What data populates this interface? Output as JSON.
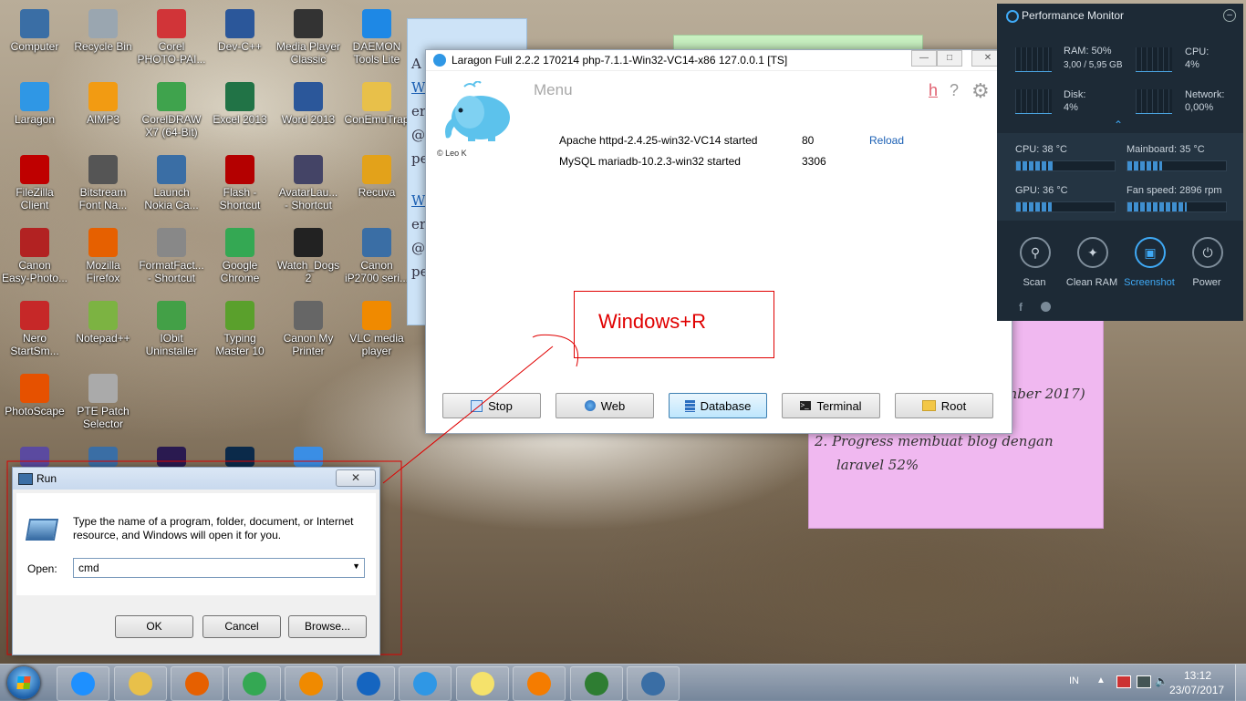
{
  "desktop": {
    "icons": [
      {
        "label": "Computer",
        "icon": "computer-icon",
        "color": "#3a6ea5"
      },
      {
        "label": "Recycle Bin",
        "icon": "recycle-bin-icon",
        "color": "#9aa6b0"
      },
      {
        "label": "Corel\nPHOTO-PAI...",
        "icon": "corel-photo-paint-icon",
        "color": "#d13438"
      },
      {
        "label": "Dev-C++",
        "icon": "devcpp-icon",
        "color": "#2b579a"
      },
      {
        "label": "Media Player\nClassic",
        "icon": "media-player-icon",
        "color": "#333333"
      },
      {
        "label": "DAEMON\nTools Lite",
        "icon": "daemon-tools-icon",
        "color": "#1e88e5"
      },
      {
        "label": "Laragon",
        "icon": "laragon-icon",
        "color": "#2f97e5"
      },
      {
        "label": "AIMP3",
        "icon": "aimp-icon",
        "color": "#f29b12"
      },
      {
        "label": "CorelDRAW\nX7 (64-Bit)",
        "icon": "coreldraw-icon",
        "color": "#3fa34d"
      },
      {
        "label": "Excel 2013",
        "icon": "excel-icon",
        "color": "#217346"
      },
      {
        "label": "Word 2013",
        "icon": "word-icon",
        "color": "#2b579a"
      },
      {
        "label": "ConEmuTrap",
        "icon": "folder-icon",
        "color": "#e8c04a"
      },
      {
        "label": "FileZilla\nClient",
        "icon": "filezilla-icon",
        "color": "#bf0000"
      },
      {
        "label": "Bitstream\nFont Na...",
        "icon": "bitstream-icon",
        "color": "#555555"
      },
      {
        "label": "Launch\nNokia Ca...",
        "icon": "nokia-icon",
        "color": "#3a6ea5"
      },
      {
        "label": "Flash -\nShortcut",
        "icon": "flash-icon",
        "color": "#b40000"
      },
      {
        "label": "AvatarLau...\n- Shortcut",
        "icon": "avatar-icon",
        "color": "#444466"
      },
      {
        "label": "Recuva",
        "icon": "recuva-icon",
        "color": "#e3a21a"
      },
      {
        "label": "Canon\nEasy-Photo...",
        "icon": "canon-icon",
        "color": "#b22222"
      },
      {
        "label": "Mozilla\nFirefox",
        "icon": "firefox-icon",
        "color": "#e66000"
      },
      {
        "label": "FormatFact...\n- Shortcut",
        "icon": "format-factory-icon",
        "color": "#888888"
      },
      {
        "label": "Google\nChrome",
        "icon": "chrome-icon",
        "color": "#34a853"
      },
      {
        "label": "Watch_Dogs\n2",
        "icon": "watchdogs-icon",
        "color": "#222222"
      },
      {
        "label": "Canon\niP2700 seri...",
        "icon": "canon-printer-icon",
        "color": "#3a6ea5"
      },
      {
        "label": "Nero\nStartSm...",
        "icon": "nero-icon",
        "color": "#c62828"
      },
      {
        "label": "Notepad++",
        "icon": "notepadpp-icon",
        "color": "#7cb342"
      },
      {
        "label": "IObit\nUninstaller",
        "icon": "iobit-icon",
        "color": "#43a047"
      },
      {
        "label": "Typing\nMaster 10",
        "icon": "typing-master-icon",
        "color": "#5aa02c"
      },
      {
        "label": "Canon My\nPrinter",
        "icon": "canon-myprinter-icon",
        "color": "#666666"
      },
      {
        "label": "VLC media\nplayer",
        "icon": "vlc-icon",
        "color": "#f08a00"
      },
      {
        "label": "PhotoScape",
        "icon": "photoscape-icon",
        "color": "#e65100"
      },
      {
        "label": "PTE Patch\nSelector",
        "icon": "pte-icon",
        "color": "#aaaaaa"
      }
    ],
    "partial_icons": [
      {
        "icon": "generic-app-icon",
        "color": "#5b4aa0"
      },
      {
        "icon": "generic-app-icon",
        "color": "#3a6ea5"
      },
      {
        "icon": "after-effects-icon",
        "color": "#2a1a50"
      },
      {
        "icon": "photoshop-icon",
        "color": "#0b2a4a"
      },
      {
        "icon": "generic-app-icon",
        "color": "#3a8ee5"
      }
    ]
  },
  "sticky_notes": {
    "left_letters": [
      "A",
      "W",
      "er",
      "@",
      "pe",
      "W",
      "er",
      "@",
      "pe"
    ],
    "pink_lines": [
      "mber 2017)",
      "2. Progress membuat blog dengan",
      "laravel 52%"
    ]
  },
  "laragon": {
    "title": "Laragon Full 2.2.2 170214 php-7.1.1-Win32-VC14-x86  127.0.0.1 [TS]",
    "menu_label": "Menu",
    "credit": "© Leo K",
    "help_h": "h",
    "help_q": "?",
    "services": [
      {
        "name": "Apache httpd-2.4.25-win32-VC14 started",
        "port": "80",
        "action": "Reload"
      },
      {
        "name": "MySQL mariadb-10.2.3-win32 started",
        "port": "3306",
        "action": ""
      }
    ],
    "buttons": [
      "Stop",
      "Web",
      "Database",
      "Terminal",
      "Root"
    ],
    "active_button": "Database"
  },
  "annotation": {
    "text": "Windows+R",
    "color": "#e00000"
  },
  "perf_monitor": {
    "title": "Performance Monitor",
    "ram_label": "RAM: 50%",
    "ram_detail": "3,00 / 5,95 GB",
    "cpu_label": "CPU:",
    "cpu_value": "4%",
    "disk_label": "Disk:",
    "disk_value": "4%",
    "network_label": "Network:",
    "network_value": "0,00%",
    "temps": [
      {
        "label": "CPU:  38 °C",
        "level": 0.38
      },
      {
        "label": "Mainboard:  35 °C",
        "level": 0.35
      },
      {
        "label": "GPU:  36 °C",
        "level": 0.36
      },
      {
        "label": "Fan speed:  2896 rpm",
        "level": 0.6
      }
    ],
    "actions": [
      "Scan",
      "Clean RAM",
      "Screenshot",
      "Power"
    ],
    "active_action": "Screenshot",
    "accent": "#3fa9f5"
  },
  "run_dialog": {
    "title": "Run",
    "description": "Type the name of a program, folder, document, or Internet resource, and Windows will open it for you.",
    "open_label": "Open:",
    "open_value": "cmd",
    "ok": "OK",
    "cancel": "Cancel",
    "browse": "Browse..."
  },
  "taskbar": {
    "items": [
      {
        "icon": "ie-icon",
        "color": "#1e90ff"
      },
      {
        "icon": "explorer-icon",
        "color": "#e8c04a"
      },
      {
        "icon": "firefox-icon",
        "color": "#e66000"
      },
      {
        "icon": "chrome-icon",
        "color": "#34a853"
      },
      {
        "icon": "media-player-icon",
        "color": "#f08a00"
      },
      {
        "icon": "ccleaner-icon",
        "color": "#1565c0"
      },
      {
        "icon": "laragon-icon",
        "color": "#2f97e5"
      },
      {
        "icon": "sticky-notes-icon",
        "color": "#f5e26b"
      },
      {
        "icon": "sublime-icon",
        "color": "#f57c00"
      },
      {
        "icon": "hs-icon",
        "color": "#2e7d32"
      },
      {
        "icon": "run-icon",
        "color": "#3a6ea5"
      }
    ],
    "lang": "IN",
    "time": "13:12",
    "date": "23/07/2017"
  }
}
